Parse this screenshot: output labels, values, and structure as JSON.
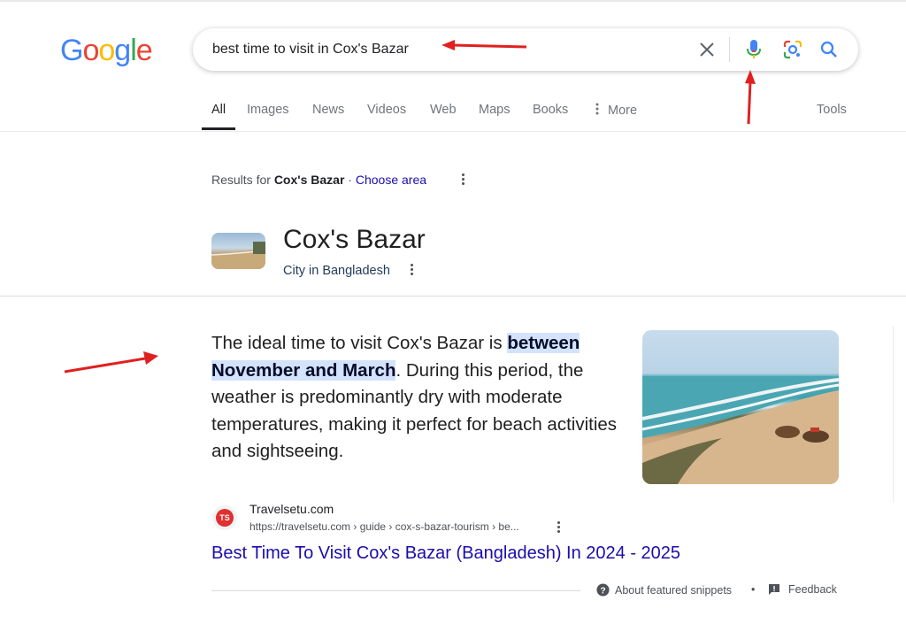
{
  "header": {
    "logo_letters": [
      "G",
      "o",
      "o",
      "g",
      "l",
      "e"
    ],
    "logo_colors": [
      "#4285F4",
      "#EA4335",
      "#FBBC05",
      "#4285F4",
      "#34A853",
      "#EA4335"
    ],
    "search_query": "best time to visit in Cox's Bazar",
    "icons": [
      "clear-icon",
      "microphone-icon",
      "google-lens-icon",
      "search-icon"
    ]
  },
  "tabs": [
    {
      "label": "All",
      "active": true
    },
    {
      "label": "Images"
    },
    {
      "label": "News"
    },
    {
      "label": "Videos"
    },
    {
      "label": "Web"
    },
    {
      "label": "Maps"
    },
    {
      "label": "Books"
    },
    {
      "label": "More"
    },
    {
      "label": "Tools"
    }
  ],
  "results_for": {
    "prefix": "Results for ",
    "place": "Cox's Bazar",
    "separator": " · ",
    "link": "Choose area"
  },
  "entity": {
    "title": "Cox's Bazar",
    "subtitle": "City in Bangladesh"
  },
  "snippet": {
    "text_before": "The ideal time to visit Cox's Bazar is ",
    "highlight": "between November and March",
    "text_after": ". During this period, the weather is predominantly dry with moderate temperatures, making it perfect for beach activities and sightseeing."
  },
  "source": {
    "favicon_text": "TS",
    "site_name": "Travelsetu.com",
    "url": "https://travelsetu.com › guide › cox-s-bazar-tourism › be...",
    "title": "Best Time To Visit Cox's Bazar (Bangladesh) In 2024 - 2025"
  },
  "footer": {
    "about": "About featured snippets",
    "dot": "•",
    "feedback": "Feedback"
  },
  "annotation_color": "#e02020"
}
